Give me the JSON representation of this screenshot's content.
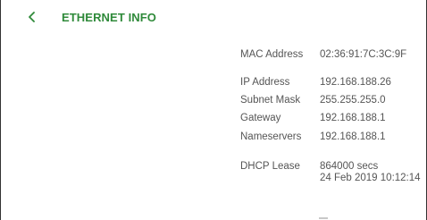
{
  "header": {
    "back_icon": "chevron-left-icon",
    "title": "ETHERNET INFO",
    "accent_color": "#2f8a3a"
  },
  "info": {
    "mac": {
      "label": "MAC Address",
      "value": "02:36:91:7C:3C:9F"
    },
    "ip": {
      "label": "IP Address",
      "value": "192.168.188.26"
    },
    "subnet": {
      "label": "Subnet Mask",
      "value": "255.255.255.0"
    },
    "gateway": {
      "label": "Gateway",
      "value": "192.168.188.1"
    },
    "nameservers": {
      "label": "Nameservers",
      "value": "192.168.188.1"
    },
    "dhcp": {
      "label": "DHCP Lease",
      "value_line1": "864000 secs",
      "value_line2": "24 Feb 2019 10:12:14"
    }
  }
}
